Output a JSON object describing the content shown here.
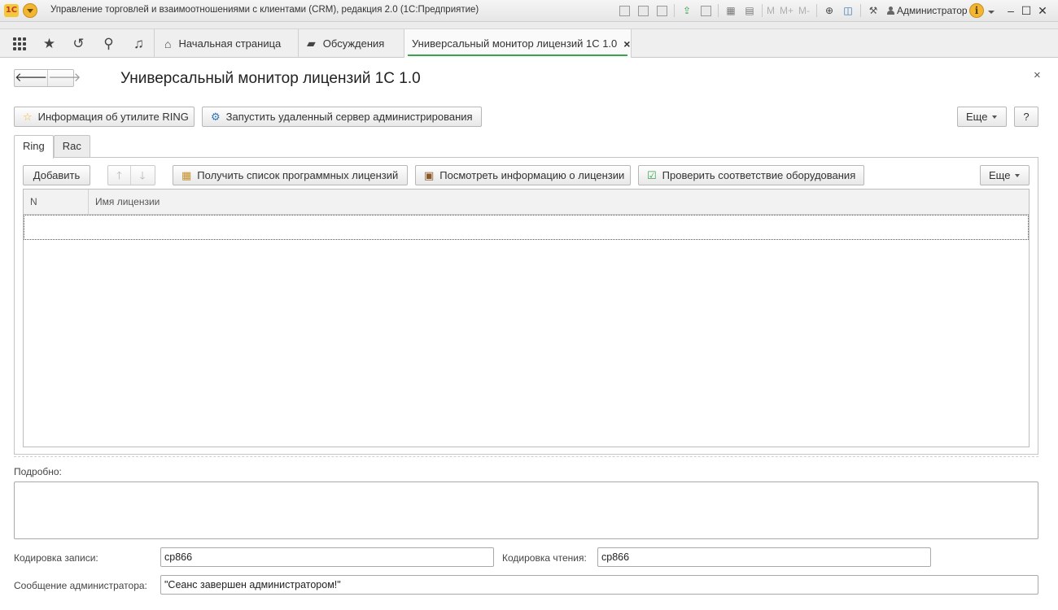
{
  "app": {
    "logo": "1С",
    "title": "Управление торговлей и взаимоотношениями с клиентами (CRM), редакция 2.0  (1С:Предприятие)",
    "toolbar_m": [
      "M",
      "M+",
      "M-"
    ],
    "user": "Администратор",
    "info_glyph": "i"
  },
  "tabs": [
    {
      "label": "Начальная страница"
    },
    {
      "label": "Обсуждения"
    },
    {
      "label": "Универсальный монитор лицензий 1С 1.0"
    }
  ],
  "form": {
    "title": "Универсальный монитор лицензий 1С 1.0",
    "buttons": {
      "ring_info": "Информация об утилите RING",
      "start_server": "Запустить удаленный сервер администрирования",
      "more": "Еще",
      "help": "?"
    },
    "inner_tabs": [
      "Ring",
      "Rac"
    ],
    "ring": {
      "add": "Добавить",
      "get_list": "Получить список программных лицензий",
      "view_info": "Посмотреть информацию о лицензии",
      "check_hw": "Проверить соответствие оборудования",
      "more": "Еще",
      "columns": [
        "N",
        "Имя лицензии"
      ]
    },
    "details_label": "Подробно:",
    "write_encoding_label": "Кодировка записи:",
    "write_encoding_value": "cp866",
    "read_encoding_label": "Кодировка чтения:",
    "read_encoding_value": "cp866",
    "admin_message_label": "Сообщение администратора:",
    "admin_message_value": "\"Сеанс завершен администратором!\""
  },
  "colors": {
    "accent_green": "#3aa44d",
    "logo_yellow": "#f5c73a"
  }
}
